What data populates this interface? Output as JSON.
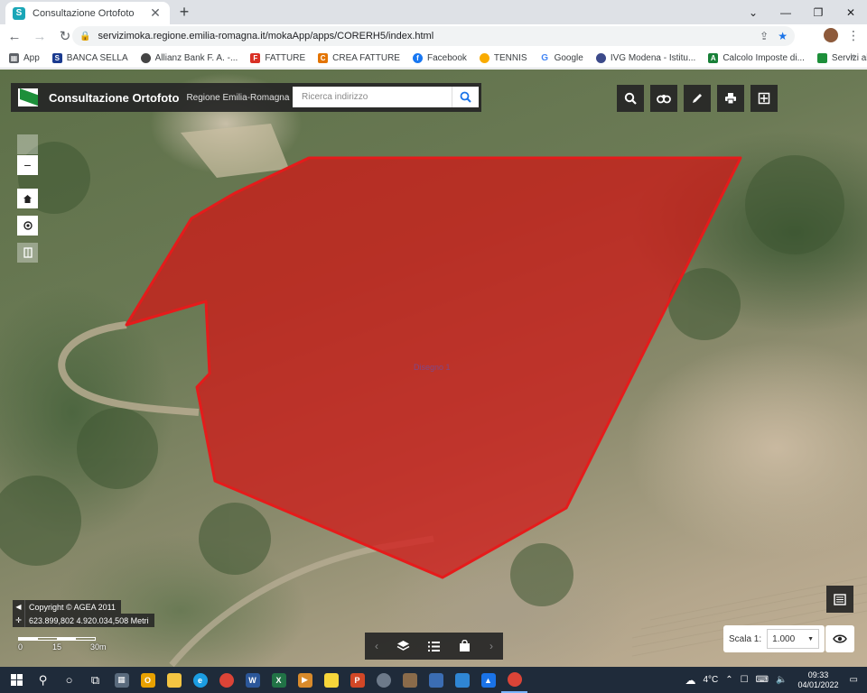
{
  "browser": {
    "tab_title": "Consultazione Ortofoto",
    "url": "servizimoka.regione.emilia-romagna.it/mokaApp/apps/CORERH5/index.html",
    "bookmarks": [
      {
        "label": "App",
        "color": "#5f6368"
      },
      {
        "label": "BANCA SELLA",
        "color": "#1a3a8f"
      },
      {
        "label": "Allianz Bank F. A. -...",
        "color": "#444444"
      },
      {
        "label": "FATTURE",
        "color": "#d93025"
      },
      {
        "label": "CREA FATTURE",
        "color": "#e37400"
      },
      {
        "label": "Facebook",
        "color": "#1877f2"
      },
      {
        "label": "TENNIS",
        "color": "#f9ab00"
      },
      {
        "label": "Google",
        "color": "#4285f4"
      },
      {
        "label": "IVG Modena - Istitu...",
        "color": "#3c4a8a"
      },
      {
        "label": "Calcolo Imposte di...",
        "color": "#188038"
      },
      {
        "label": "Servizi al cittadino...",
        "color": "#1d8f3a"
      }
    ],
    "bookmarks_more": "»"
  },
  "app": {
    "title": "Consultazione Ortofoto",
    "region": "Regione Emilia-Romagna",
    "search_placeholder": "Ricerca indirizzo"
  },
  "map": {
    "polygon_label": "Disegno 1",
    "copyright": "Copyright © AGEA 2011",
    "coordinates": "623.899,802 4.920.034,508 Metri",
    "scalebar_ticks": [
      "0",
      "15",
      "30m"
    ],
    "zoom_out_label": "−",
    "scale_label": "Scala 1:",
    "scale_value": "1.000"
  },
  "colors": {
    "polygon_fill": "#d41414",
    "polygon_stroke": "#e51b1b",
    "panel": "#262626",
    "accent_green": "#1d8f3a"
  },
  "taskbar": {
    "weather": "4°C",
    "time": "09:33",
    "date": "04/01/2022"
  }
}
